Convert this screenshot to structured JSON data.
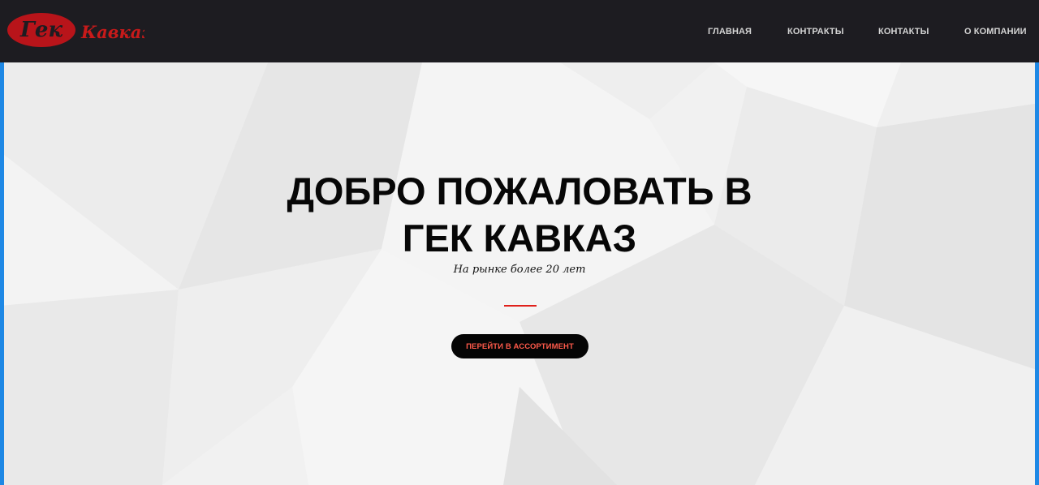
{
  "header": {
    "logo": {
      "mark_text": "Гек",
      "word_text": "Кавказ",
      "mark_color": "#c81a1a",
      "word_color": "#c81a1a"
    },
    "nav": [
      {
        "label": "ГЛАВНАЯ"
      },
      {
        "label": "КОНТРАКТЫ"
      },
      {
        "label": "КОНТАКТЫ"
      },
      {
        "label": "О КОМПАНИИ"
      }
    ]
  },
  "hero": {
    "title_line1": "ДОБРО ПОЖАЛОВАТЬ В",
    "title_line2": "ГЕК КАВКАЗ",
    "subtitle": "На рынке более 20 лет",
    "cta_label": "ПЕРЕЙТИ В АССОРТИМЕНТ",
    "accent_color": "#e0201a"
  }
}
